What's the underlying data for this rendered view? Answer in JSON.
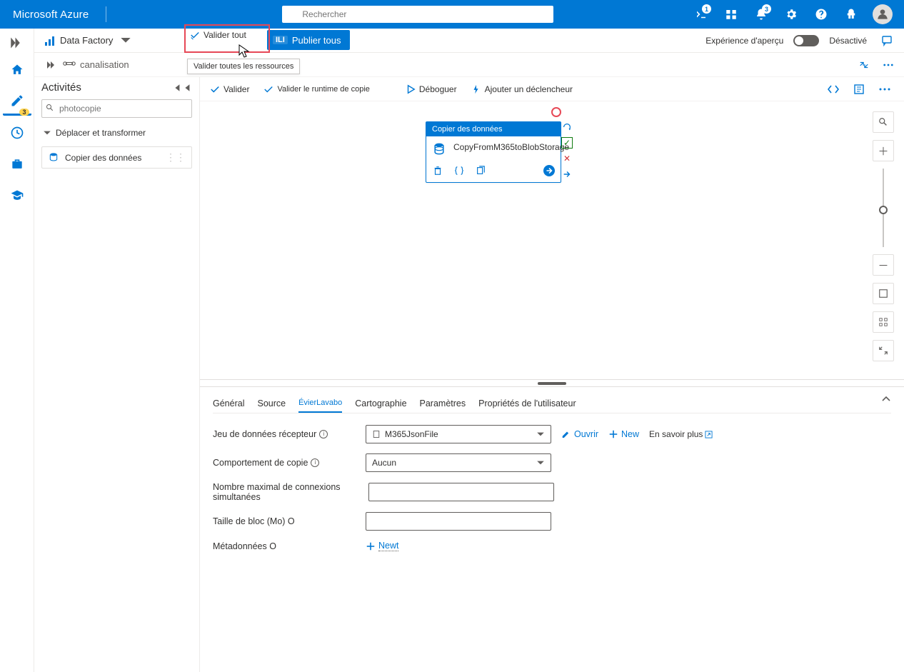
{
  "header": {
    "brand": "Microsoft Azure",
    "search_placeholder": "Rechercher",
    "badge_directline": "1",
    "badge_notifications": "3"
  },
  "toolbar": {
    "product": "Data Factory",
    "validate_all": "Valider tout",
    "validate_tooltip": "Valider toutes les ressources",
    "publish_prefix": "ILI",
    "publish_label": "Publier tous",
    "preview_label": "Expérience d'aperçu",
    "preview_state": "Désactivé"
  },
  "breadcrumb": {
    "label": "canalisation"
  },
  "left_rail": {
    "edit_badge": "3"
  },
  "activities": {
    "title": "Activités",
    "search_placeholder": "photocopie",
    "section": "Déplacer et transformer",
    "item_copy": "Copier des données"
  },
  "canvas_toolbar": {
    "validate": "Valider",
    "validate_runtime": "Valider le runtime de copie",
    "debug": "Déboguer",
    "add_trigger": "Ajouter un déclencheur"
  },
  "node": {
    "head": "Copier des données",
    "name": "CopyFromM365toBlobStorage"
  },
  "tabs": {
    "general": "Général",
    "source": "Source",
    "sink": "ÉvierLavabo",
    "mapping": "Cartographie",
    "params": "Paramètres",
    "userprops": "Propriétés de l'utilisateur"
  },
  "form": {
    "sink_dataset_label": "Jeu de données récepteur",
    "sink_dataset_value": "M365JsonFile",
    "open": "Ouvrir",
    "new": "New",
    "learn_more": "En savoir plus",
    "copy_behavior_label": "Comportement de copie",
    "copy_behavior_value": "Aucun",
    "max_conns_label": "Nombre maximal de connexions simultanées",
    "block_size_label": "Taille de bloc (Mo) O",
    "metadata_label": "Métadonnées O",
    "metadata_new": "Newt"
  }
}
